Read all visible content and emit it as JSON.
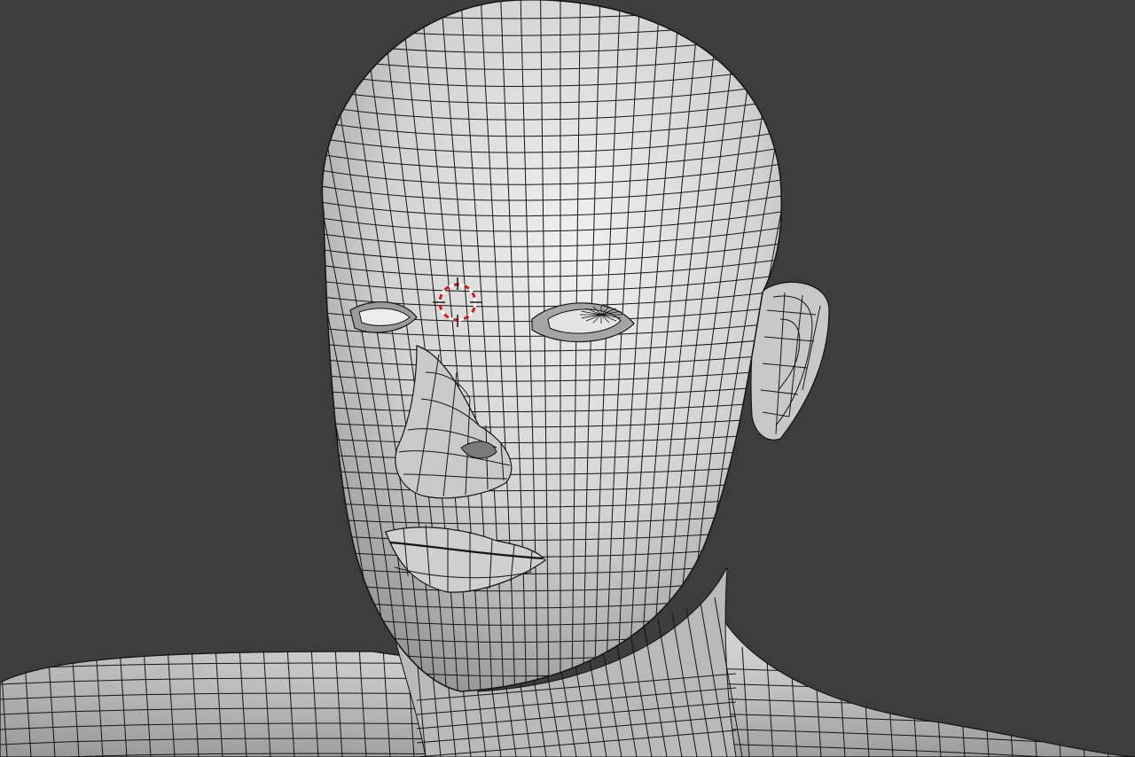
{
  "viewport": {
    "background_color": "#3d3d3d",
    "mesh_fill_color": "#d6d6d6",
    "mesh_highlight_color": "#f0f0f0",
    "mesh_shadow_color": "#8c8c8c",
    "wire_color": "#141414"
  },
  "cursor_3d": {
    "icon": "3d-cursor-icon",
    "ring_color_primary": "#ffffff",
    "ring_color_secondary": "#d11a1a"
  }
}
